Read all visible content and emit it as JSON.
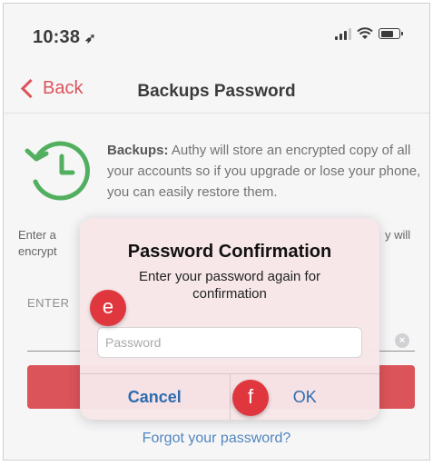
{
  "status_bar": {
    "time": "10:38"
  },
  "nav": {
    "back_label": "Back",
    "title": "Backups Password"
  },
  "info": {
    "label": "Backups:",
    "text": "Authy will store an encrypted copy of all your accounts so if you upgrade or lose your phone, you can easily restore them."
  },
  "background": {
    "enter_fragment": "Enter a",
    "encrypt_fragment": "encrypt",
    "will_fragment": "y will",
    "field_label": "ENTER"
  },
  "dialog": {
    "title": "Password Confirmation",
    "message": "Enter your password again for confirmation",
    "input_placeholder": "Password",
    "cancel_label": "Cancel",
    "ok_label": "OK"
  },
  "forgot_link": "Forgot your password?",
  "markers": {
    "e": "e",
    "f": "f"
  },
  "colors": {
    "accent_red": "#d32f36",
    "link_blue": "#2b6cb0",
    "icon_green": "#2e9e3e"
  }
}
